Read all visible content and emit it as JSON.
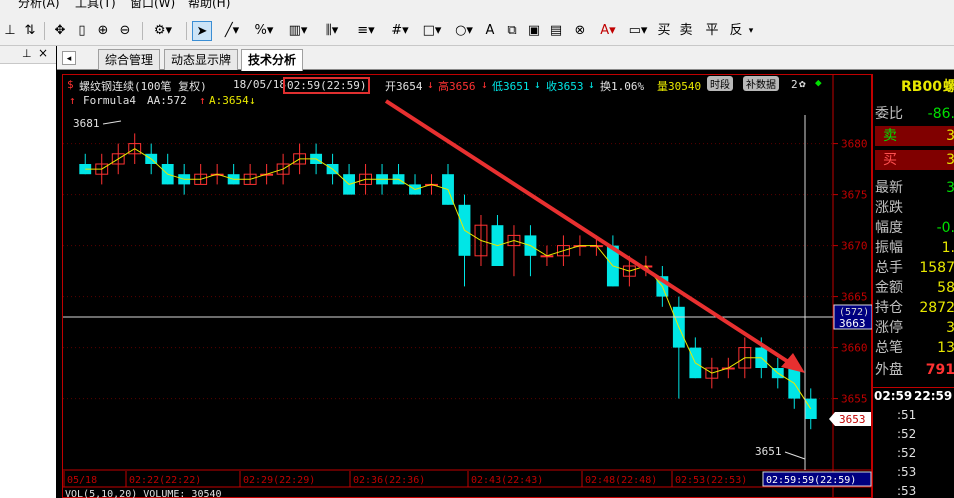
{
  "menu": {
    "items": [
      "分析(A)",
      "工具(T)",
      "窗口(W)",
      "帮助(H)"
    ]
  },
  "toolbar": {
    "icons": [
      "tb-icon-1",
      "tb-icon-2",
      "move-icon",
      "bar-icon",
      "zoom-in-icon",
      "zoom-out-icon",
      "gear-icon",
      "cursor-icon",
      "line-icon",
      "percent-icon",
      "grid-icon",
      "parallel-icon",
      "hash-icon",
      "rect-icon",
      "ellipse-icon",
      "text-icon",
      "copy-icon",
      "clipboard-icon",
      "delete-icon",
      "color-icon",
      "save-icon"
    ],
    "text_buttons": [
      "买",
      "卖",
      "平",
      "反"
    ]
  },
  "tabs": [
    "综合管理",
    "动态显示牌",
    "技术分析"
  ],
  "chart_header": {
    "symbol": "螺纹钢连续(100笔 复权)",
    "date": "18/05/18",
    "time": "02:59(22:59)",
    "open": "开3654",
    "high": "高3656",
    "low": "低3651",
    "close": "收3653",
    "turnover": "换1.06%",
    "volume": "量30540",
    "btn_period": "时段",
    "btn_supplement": "补数据",
    "extra": "2",
    "formula": "Formula4",
    "aa": "AA:572",
    "a": "A:3654"
  },
  "chart_data": {
    "type": "candlestick",
    "ylim": [
      3648,
      3683
    ],
    "y_ticks": [
      3680,
      3675,
      3670,
      3665,
      3660,
      3655
    ],
    "candles": [
      {
        "o": 3678,
        "h": 3679,
        "l": 3677,
        "c": 3677
      },
      {
        "o": 3677,
        "h": 3679,
        "l": 3676,
        "c": 3678
      },
      {
        "o": 3678,
        "h": 3680,
        "l": 3677,
        "c": 3679
      },
      {
        "o": 3679,
        "h": 3681,
        "l": 3678,
        "c": 3680
      },
      {
        "o": 3679,
        "h": 3680,
        "l": 3677,
        "c": 3678
      },
      {
        "o": 3678,
        "h": 3679,
        "l": 3676,
        "c": 3676
      },
      {
        "o": 3677,
        "h": 3678,
        "l": 3675,
        "c": 3676
      },
      {
        "o": 3676,
        "h": 3678,
        "l": 3676,
        "c": 3677
      },
      {
        "o": 3677,
        "h": 3678,
        "l": 3676,
        "c": 3677
      },
      {
        "o": 3677,
        "h": 3678,
        "l": 3676,
        "c": 3676
      },
      {
        "o": 3676,
        "h": 3678,
        "l": 3676,
        "c": 3677
      },
      {
        "o": 3677,
        "h": 3678,
        "l": 3676,
        "c": 3677
      },
      {
        "o": 3677,
        "h": 3679,
        "l": 3676,
        "c": 3678
      },
      {
        "o": 3678,
        "h": 3680,
        "l": 3677,
        "c": 3679
      },
      {
        "o": 3679,
        "h": 3680,
        "l": 3677,
        "c": 3678
      },
      {
        "o": 3678,
        "h": 3679,
        "l": 3676,
        "c": 3677
      },
      {
        "o": 3677,
        "h": 3678,
        "l": 3675,
        "c": 3675
      },
      {
        "o": 3676,
        "h": 3678,
        "l": 3675,
        "c": 3677
      },
      {
        "o": 3677,
        "h": 3678,
        "l": 3675,
        "c": 3676
      },
      {
        "o": 3677,
        "h": 3678,
        "l": 3676,
        "c": 3676
      },
      {
        "o": 3676,
        "h": 3677,
        "l": 3675,
        "c": 3675
      },
      {
        "o": 3676,
        "h": 3677,
        "l": 3675,
        "c": 3676
      },
      {
        "o": 3677,
        "h": 3678,
        "l": 3674,
        "c": 3674
      },
      {
        "o": 3674,
        "h": 3675,
        "l": 3666,
        "c": 3669
      },
      {
        "o": 3669,
        "h": 3673,
        "l": 3668,
        "c": 3672
      },
      {
        "o": 3672,
        "h": 3673,
        "l": 3668,
        "c": 3668
      },
      {
        "o": 3670,
        "h": 3672,
        "l": 3667,
        "c": 3671
      },
      {
        "o": 3671,
        "h": 3672,
        "l": 3667,
        "c": 3669
      },
      {
        "o": 3669,
        "h": 3670,
        "l": 3668,
        "c": 3669
      },
      {
        "o": 3669,
        "h": 3671,
        "l": 3668,
        "c": 3670
      },
      {
        "o": 3670,
        "h": 3671,
        "l": 3669,
        "c": 3670
      },
      {
        "o": 3670,
        "h": 3671,
        "l": 3669,
        "c": 3670
      },
      {
        "o": 3670,
        "h": 3671,
        "l": 3666,
        "c": 3666
      },
      {
        "o": 3667,
        "h": 3669,
        "l": 3666,
        "c": 3668
      },
      {
        "o": 3668,
        "h": 3669,
        "l": 3667,
        "c": 3668
      },
      {
        "o": 3667,
        "h": 3668,
        "l": 3664,
        "c": 3665
      },
      {
        "o": 3664,
        "h": 3665,
        "l": 3655,
        "c": 3660
      },
      {
        "o": 3660,
        "h": 3661,
        "l": 3657,
        "c": 3657
      },
      {
        "o": 3657,
        "h": 3659,
        "l": 3656,
        "c": 3658
      },
      {
        "o": 3658,
        "h": 3659,
        "l": 3657,
        "c": 3658
      },
      {
        "o": 3658,
        "h": 3661,
        "l": 3657,
        "c": 3660
      },
      {
        "o": 3660,
        "h": 3661,
        "l": 3657,
        "c": 3658
      },
      {
        "o": 3658,
        "h": 3659,
        "l": 3656,
        "c": 3657
      },
      {
        "o": 3658,
        "h": 3659,
        "l": 3654,
        "c": 3655
      },
      {
        "o": 3655,
        "h": 3656,
        "l": 3652,
        "c": 3653
      }
    ],
    "max_label": "3681",
    "min_label": "3651",
    "crosshair_price": "3663",
    "crosshair_aa": "(572)",
    "last_price": "3653",
    "time_labels": [
      "05/18",
      "02:22(22:22)",
      "02:29(22:29)",
      "02:36(22:36)",
      "02:43(22:43)",
      "02:48(22:48)",
      "02:53(22:53)"
    ],
    "cursor_time": "02:59:59(22:59)",
    "bottom_indicator": "VOL(5,10,20)  VOLUME: 30540"
  },
  "quote_panel": {
    "symbol": "RB00",
    "symbol_suffix": "螺",
    "rows": [
      {
        "label": "委比",
        "value": "-86."
      },
      {
        "label": "卖",
        "value": "3"
      },
      {
        "label": "买",
        "value": "3"
      },
      {
        "label": "最新",
        "value": "3"
      },
      {
        "label": "涨跌",
        "value": ""
      },
      {
        "label": "幅度",
        "value": "-0."
      },
      {
        "label": "振幅",
        "value": "1."
      },
      {
        "label": "总手",
        "value": "1587"
      },
      {
        "label": "金额",
        "value": "58"
      },
      {
        "label": "持仓",
        "value": "2872"
      },
      {
        "label": "涨停",
        "value": "3"
      },
      {
        "label": "总笔",
        "value": "13"
      },
      {
        "label": "外盘",
        "value": "791"
      }
    ],
    "time_header": "02:59",
    "time_header2": "22:59",
    "ticks": [
      ":51",
      ":52",
      ":52",
      ":53",
      ":53"
    ],
    "colors": {
      "up": "#ff3232",
      "down": "#00e6e6",
      "accent": "#c00000"
    }
  }
}
